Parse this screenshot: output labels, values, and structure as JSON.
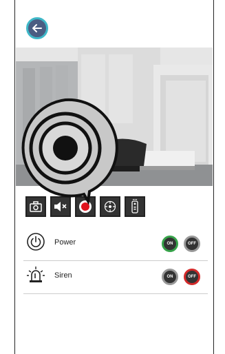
{
  "icons": {
    "back": "arrow-left-icon",
    "snapshot": "camera-icon",
    "mute": "speaker-mute-icon",
    "record": "record-icon",
    "ptz": "ptz-target-icon",
    "remote": "remote-icon"
  },
  "controls": [
    {
      "name": "power",
      "label": "Power",
      "on_label": "ON",
      "off_label": "OFF",
      "state": "on"
    },
    {
      "name": "siren",
      "label": "Siren",
      "on_label": "ON",
      "off_label": "OFF",
      "state": "off"
    }
  ],
  "colors": {
    "accent": "#3fb8c8",
    "on_green": "#37a34a",
    "off_red": "#d32a2a",
    "record_red": "#e0141e"
  }
}
